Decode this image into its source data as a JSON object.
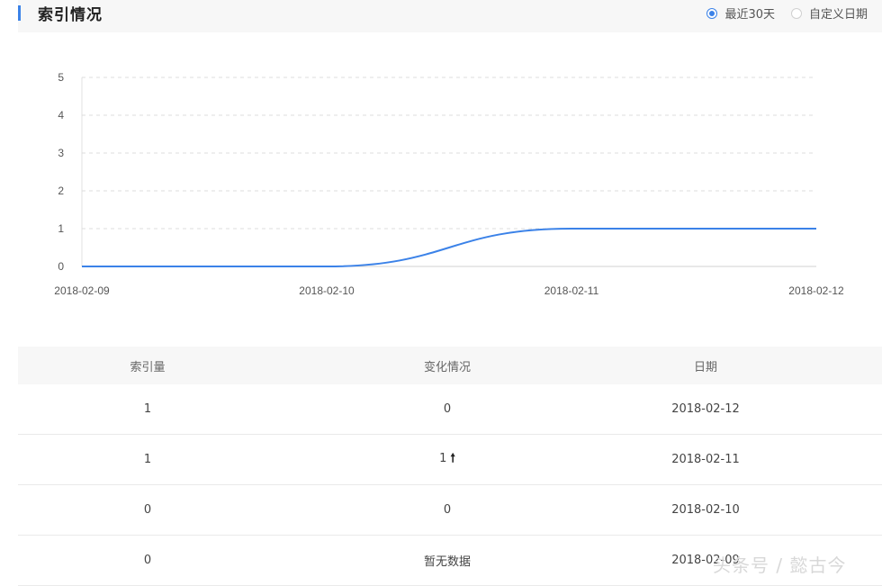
{
  "header": {
    "title": "索引情况",
    "radio_options": [
      {
        "label": "最近30天",
        "checked": true
      },
      {
        "label": "自定义日期",
        "checked": false
      }
    ]
  },
  "chart_data": {
    "type": "line",
    "x": [
      "2018-02-09",
      "2018-02-10",
      "2018-02-11",
      "2018-02-12"
    ],
    "series": [
      {
        "values": [
          0,
          0,
          1,
          1
        ]
      }
    ],
    "ylim": [
      0,
      5
    ],
    "yticks": [
      0,
      1,
      2,
      3,
      4,
      5
    ],
    "grid": true,
    "line_color": "#3b82e8"
  },
  "table": {
    "headers": [
      "索引量",
      "变化情况",
      "日期"
    ],
    "rows": [
      {
        "index": "1",
        "change": "0",
        "up": false,
        "date": "2018-02-12"
      },
      {
        "index": "1",
        "change": "1",
        "up": true,
        "date": "2018-02-11"
      },
      {
        "index": "0",
        "change": "0",
        "up": false,
        "date": "2018-02-10"
      },
      {
        "index": "0",
        "change": "暂无数据",
        "up": false,
        "date": "2018-02-09"
      }
    ]
  },
  "watermark": "头条号 / 懿古今"
}
